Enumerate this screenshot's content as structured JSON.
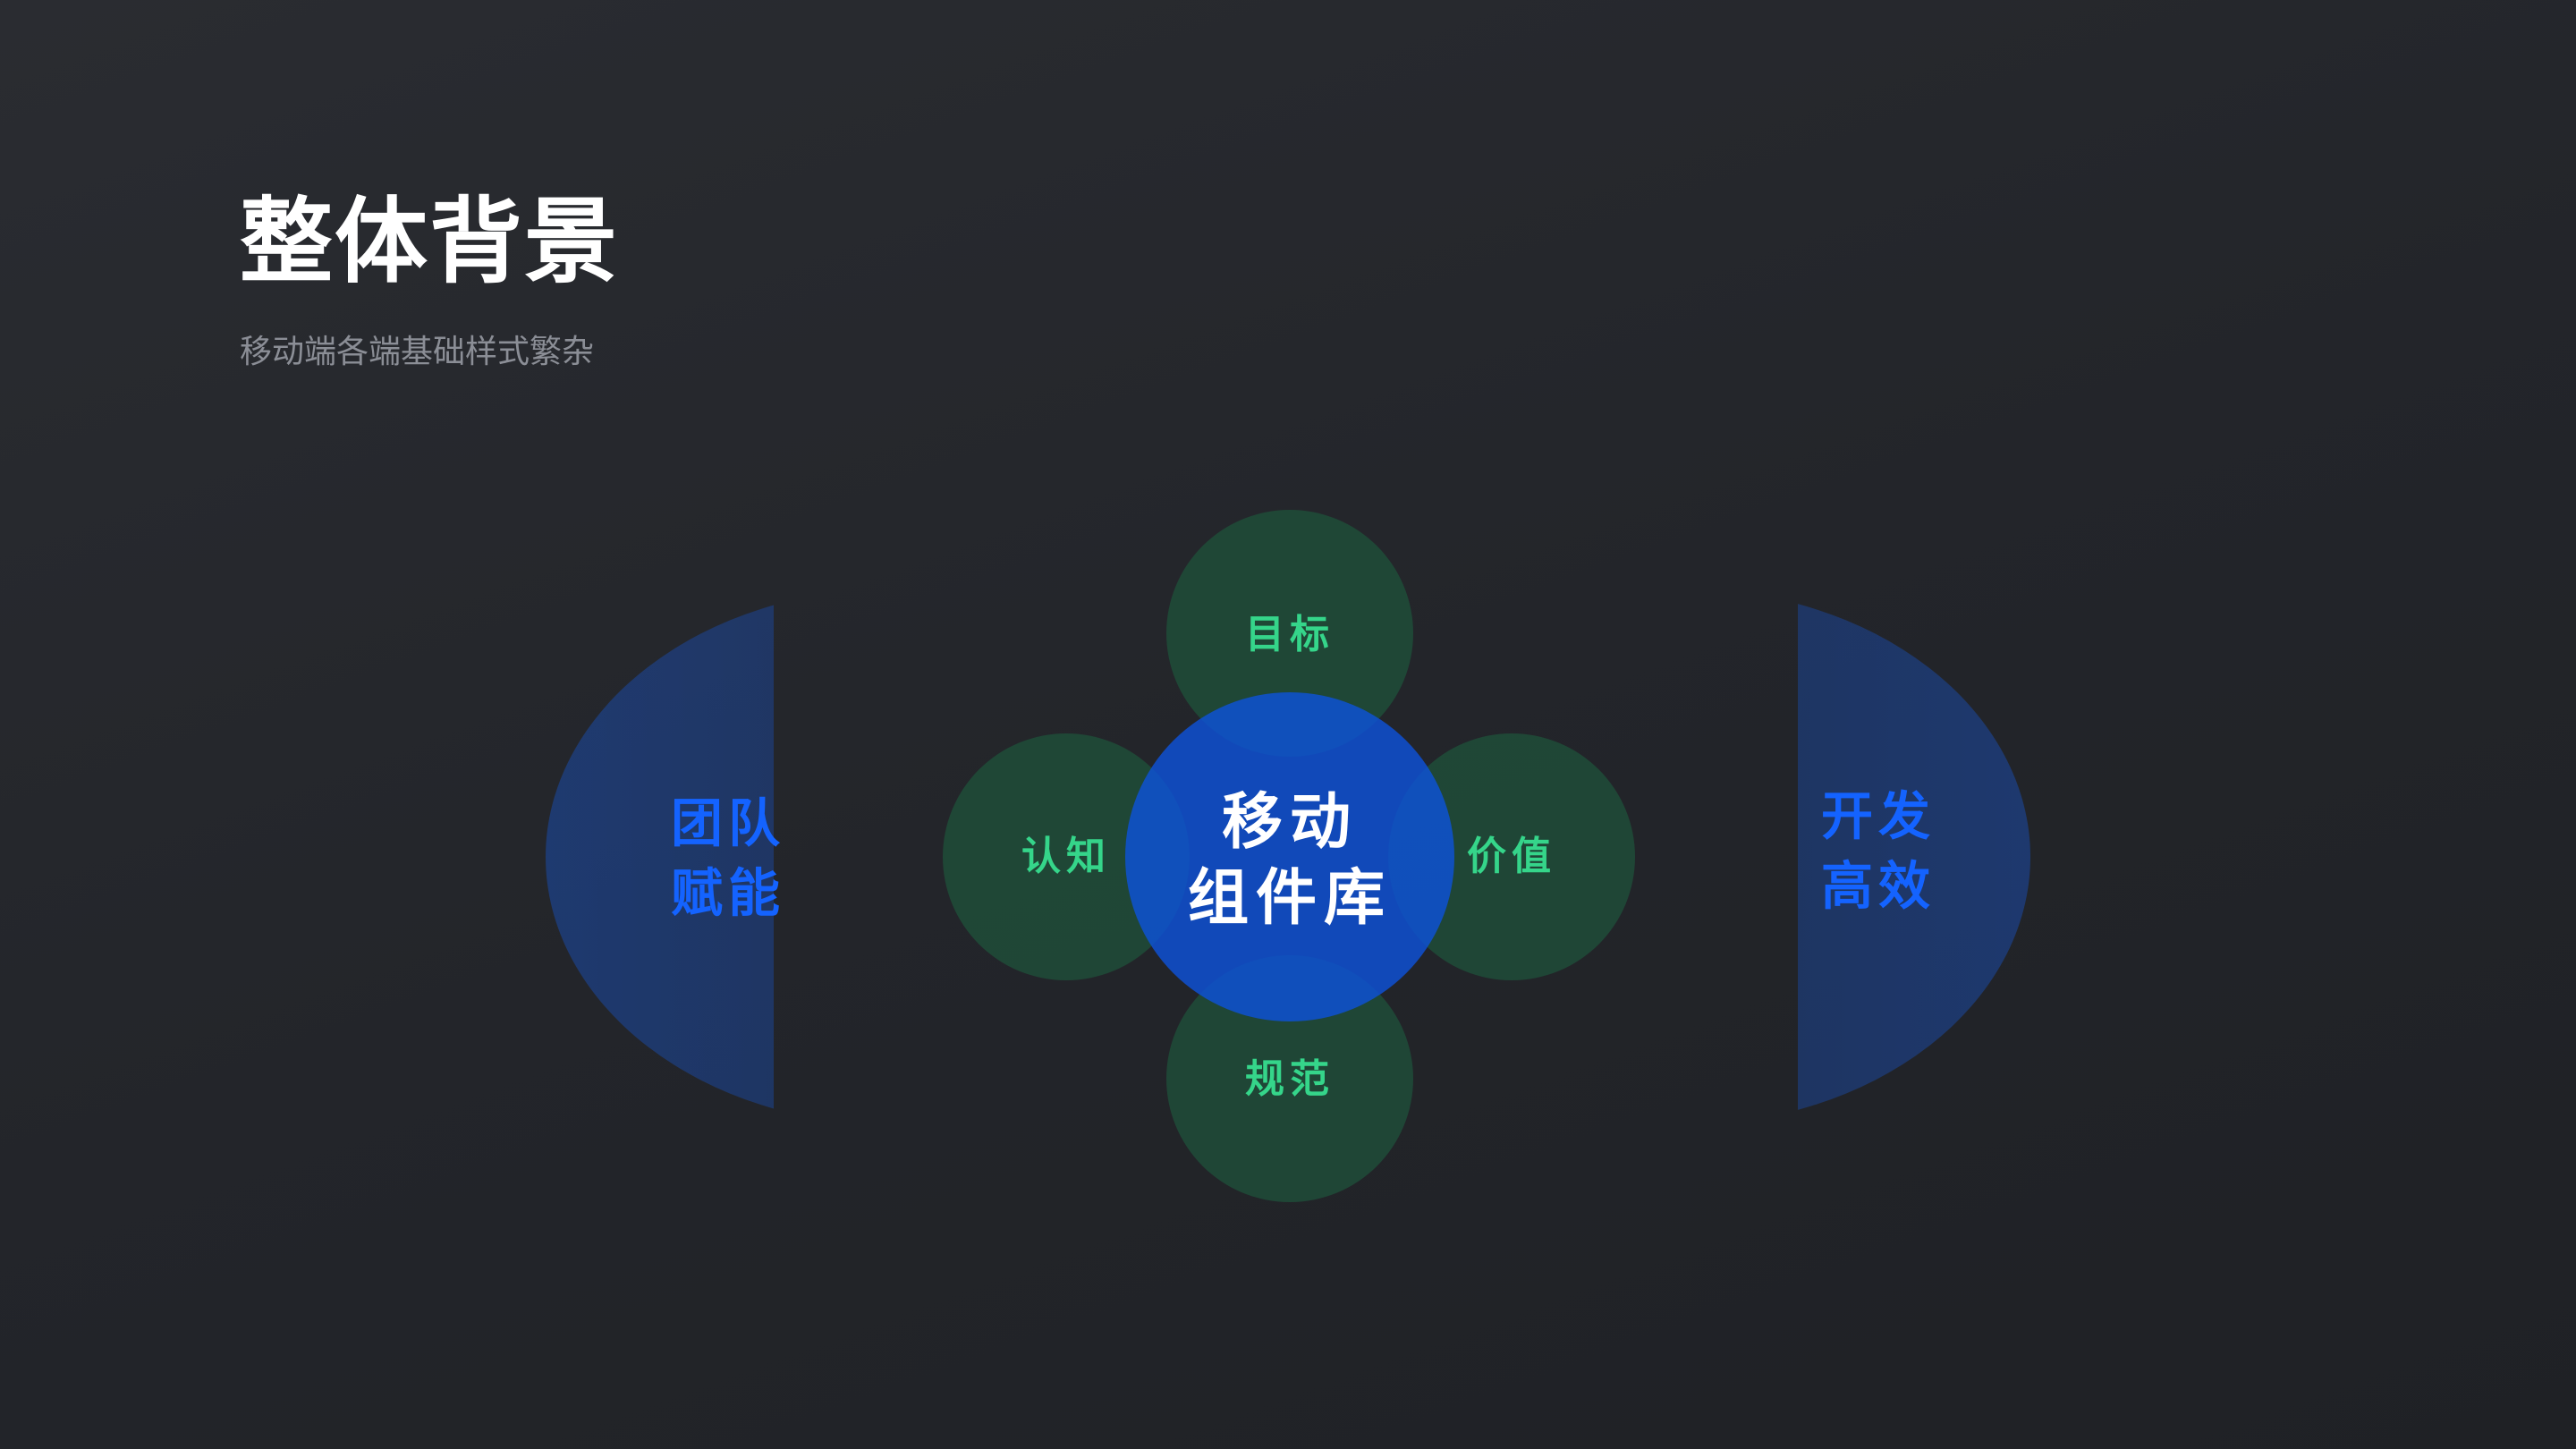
{
  "header": {
    "title": "整体背景",
    "subtitle": "移动端各端基础样式繁杂"
  },
  "diagram": {
    "center": {
      "line1": "移动",
      "line2": "组件库"
    },
    "satellites": {
      "top": "目标",
      "left": "认知",
      "right": "价值",
      "bottom": "规范"
    },
    "left_wing": {
      "line1": "团队",
      "line2": "赋能"
    },
    "right_wing": {
      "line1": "开发",
      "line2": "高效"
    }
  },
  "colors": {
    "background": "#25272c",
    "satellite_fill": "#1f4a37",
    "satellite_text": "#35d58a",
    "center_fill": "#0d52d9",
    "wing_text": "#1463ff",
    "wing_fill": "#1a4aa8"
  }
}
